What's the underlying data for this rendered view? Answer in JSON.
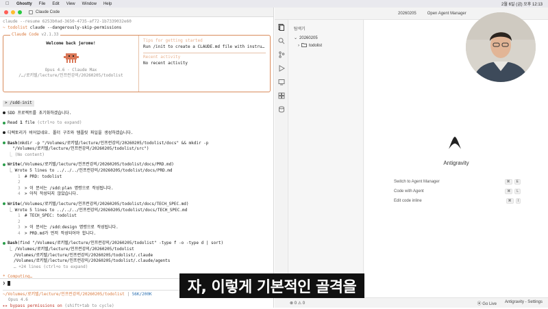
{
  "menubar": {
    "app": "Ghostty",
    "items": [
      "File",
      "Edit",
      "View",
      "Window",
      "Help"
    ],
    "clock": "2월 6일 (금) 오후 12:13"
  },
  "terminal": {
    "title": "Claude Code",
    "line1": "claude --resume 6253b0ad-3650-4735-af72-1b7339032e60",
    "line2_dir": "todolist",
    "line2_cmd": "claude --dangerously-skip-permissions",
    "box_label": "Claude Code",
    "box_version": "v2.1.33",
    "welcome": "Welcome back jerome!",
    "model_line": "Opus 4.6 · Claude Max",
    "path_line": "/…/로키텔/lecture/인프런강의/20260205/todolist",
    "tips_title": "Tips for getting started",
    "tips_text": "Run /init to create a CLAUDE.md file with instru…",
    "recent_title": "Recent activity",
    "recent_text": "No recent activity",
    "cmd_tag": "/sdd-init",
    "msg1": "SDD 프로젝트를 초기화하겠습니다.",
    "read_label": "Read",
    "read_count": "1",
    "read_rest": "file",
    "expand_hint": "(ctrl+o to expand)",
    "msg2": "디렉토리가 비어있네요. 폴더 구조와 템플릿 파일을 생성하겠습니다.",
    "bash1_label": "Bash",
    "bash1_cmd": "(mkdir -p \"/Volumes/로키텔/lecture/인프런강의/20260205/todolist/docs\" && mkdir -p",
    "bash1_cmd2": "\"/Volumes/로키텔/lecture/인프런강의/20260205/todolist/src\")",
    "no_content": "(No content)",
    "write1_label": "Write",
    "write1_path": "(/Volumes/로키텔/lecture/인프런강의/20260205/todolist/docs/PRD.md)",
    "write1_summary": "Wrote 5 lines to ../../../인프런강의/20260205/todolist/docs/PRD.md",
    "prd_lines": [
      {
        "n": "1",
        "t": "# PRD: todolist"
      },
      {
        "n": "2",
        "t": ""
      },
      {
        "n": "3",
        "t": "> 이 문서는 /sdd:plan 명령으로 작성됩니다."
      },
      {
        "n": "4",
        "t": "> 아직 작성되지 않았습니다."
      }
    ],
    "write2_label": "Write",
    "write2_path": "(/Volumes/로키텔/lecture/인프런강의/20260205/todolist/docs/TECH_SPEC.md)",
    "write2_summary": "Wrote 5 lines to ../../../인프런강의/20260205/todolist/docs/TECH_SPEC.md",
    "spec_lines": [
      {
        "n": "1",
        "t": "# TECH_SPEC: todolist"
      },
      {
        "n": "2",
        "t": ""
      },
      {
        "n": "3",
        "t": "> 이 문서는 /sdd:design 명령으로 작성됩니다."
      },
      {
        "n": "4",
        "t": "> PRD.md가 먼저 작성되어야 합니다."
      }
    ],
    "bash2_label": "Bash",
    "bash2_cmd": "(find \"/Volumes/로키텔/lecture/인프런강의/20260205/todolist\" -type f -o -type d | sort)",
    "find_lines": [
      "/Volumes/로키텔/lecture/인프런강의/20260205/todolist",
      "/Volumes/로키텔/lecture/인프런강의/20260205/todolist/.claude",
      "/Volumes/로키텔/lecture/인프런강의/20260205/todolist/.claude/agents"
    ],
    "more_lines": "… +24 lines (ctrl+o to expand)",
    "computing": "Computing…",
    "prompt_symbol": "❯",
    "status_path": "~/Volumes/로키텔/lecture/인프런강의/20260205/todolist",
    "status_tokens": "56K/200K",
    "status_model": "Opus 4.6",
    "bypass": "bypass permissions on",
    "bypass_hint": "(shift+tab to cycle)"
  },
  "ide": {
    "project": "20260205",
    "open_agent_manager": "Open Agent Manager",
    "explorer_title": "탐색기",
    "root_folder": "20260205",
    "folder": "todolist",
    "brand": "Antigravity",
    "shortcuts": [
      {
        "label": "Switch to Agent Manager",
        "k1": "⌘",
        "k2": "E"
      },
      {
        "label": "Code with Agent",
        "k1": "⌘",
        "k2": "L"
      },
      {
        "label": "Edit code inline",
        "k1": "⌘",
        "k2": "I"
      }
    ],
    "status_errors": "0",
    "status_warnings": "0",
    "go_live": "Go Live",
    "settings": "Antigravity - Settings"
  },
  "subtitle": "자, 이렇게 기본적인 골격을",
  "colors": {
    "accent": "#d9773a",
    "red": "#ff5f57",
    "yellow": "#febc2e",
    "green": "#28c840"
  }
}
